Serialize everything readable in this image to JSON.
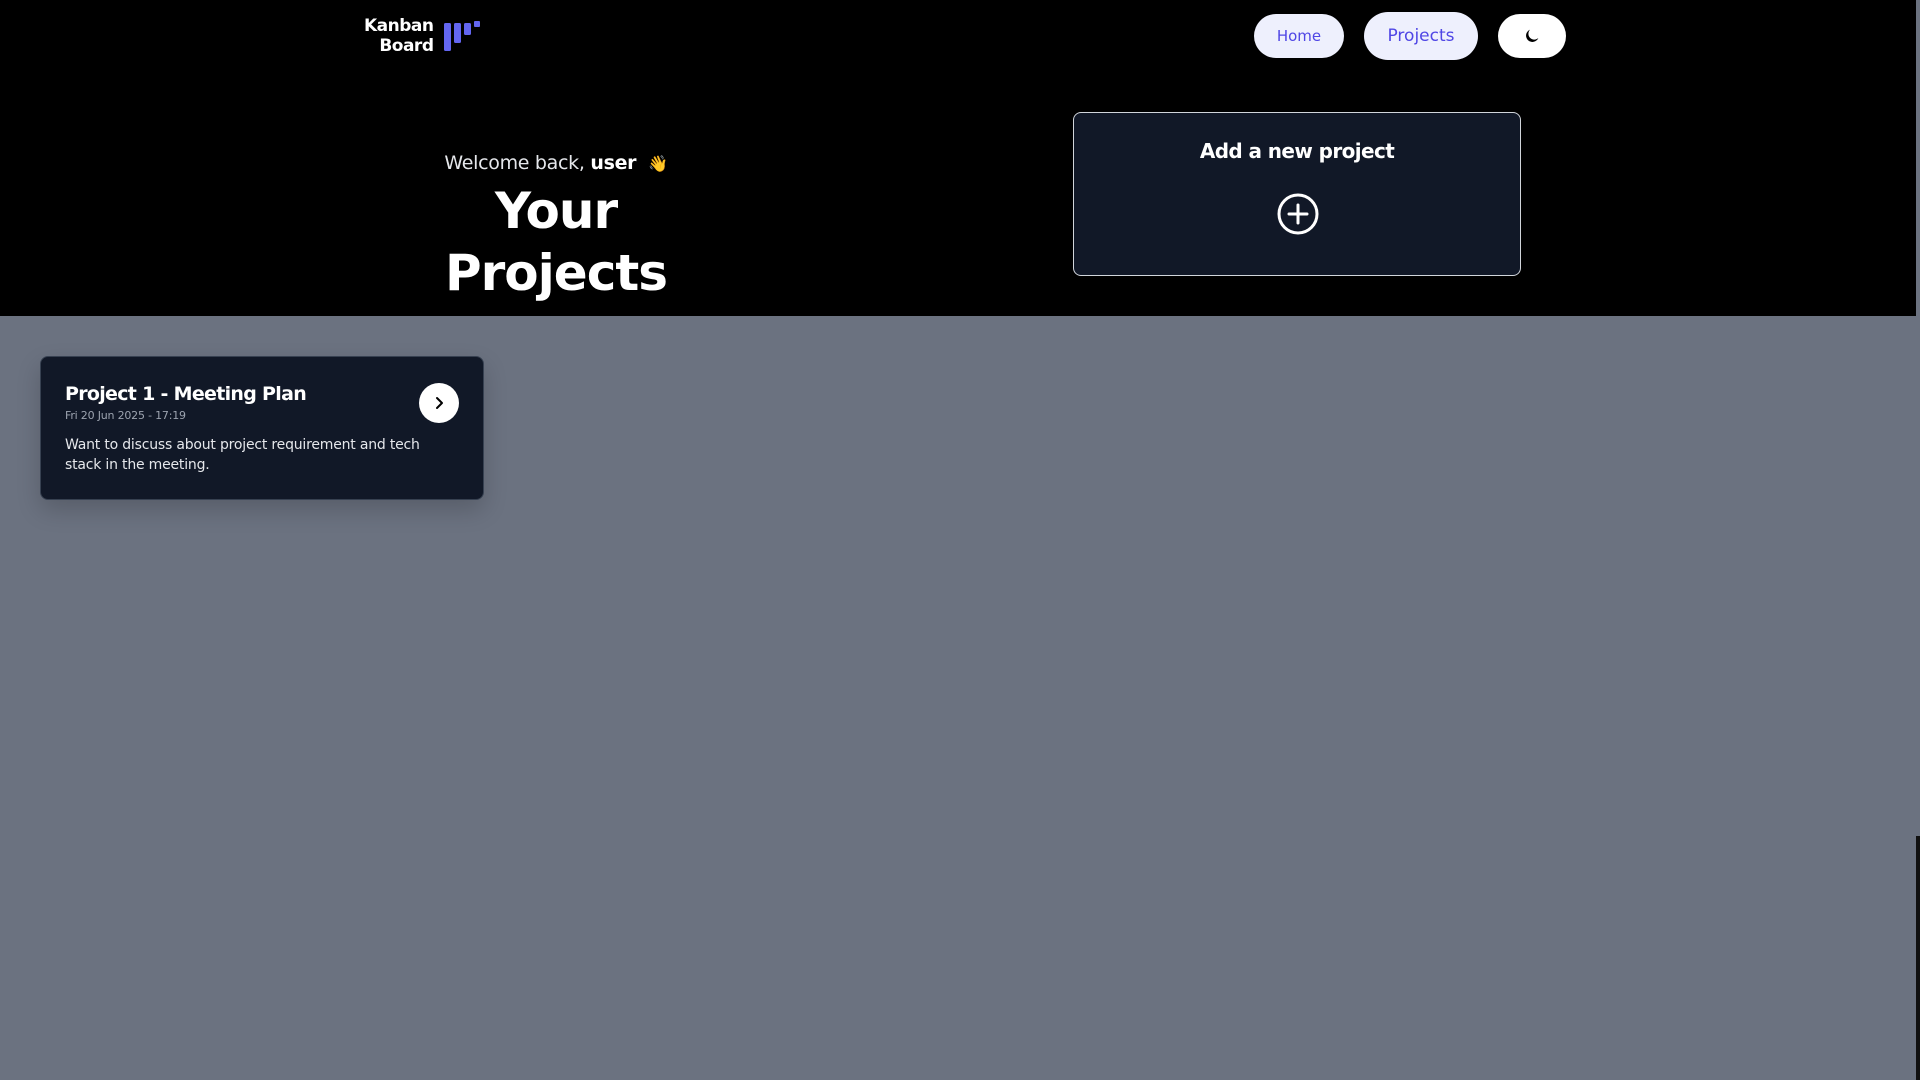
{
  "header": {
    "logo_line1": "Kanban",
    "logo_line2": "Board",
    "nav": {
      "home": "Home",
      "projects": "Projects"
    },
    "theme_icon": "moon-icon"
  },
  "hero": {
    "welcome_prefix": "Welcome back,",
    "user_name": "user",
    "wave_emoji": "👋",
    "title": "Your Projects"
  },
  "add_project": {
    "label": "Add a new project",
    "icon": "plus-circle-icon"
  },
  "projects": [
    {
      "title": "Project 1 - Meeting Plan",
      "date": "Fri 20 Jun 2025 - 17:19",
      "description": "Want to discuss about project requirement and tech stack in the meeting.",
      "open_icon": "chevron-right-icon"
    }
  ],
  "colors": {
    "header_bg": "#000000",
    "page_bg": "#6b7280",
    "card_bg": "#111827",
    "accent": "#4f46e5",
    "logo_accent": "#6366f1"
  }
}
